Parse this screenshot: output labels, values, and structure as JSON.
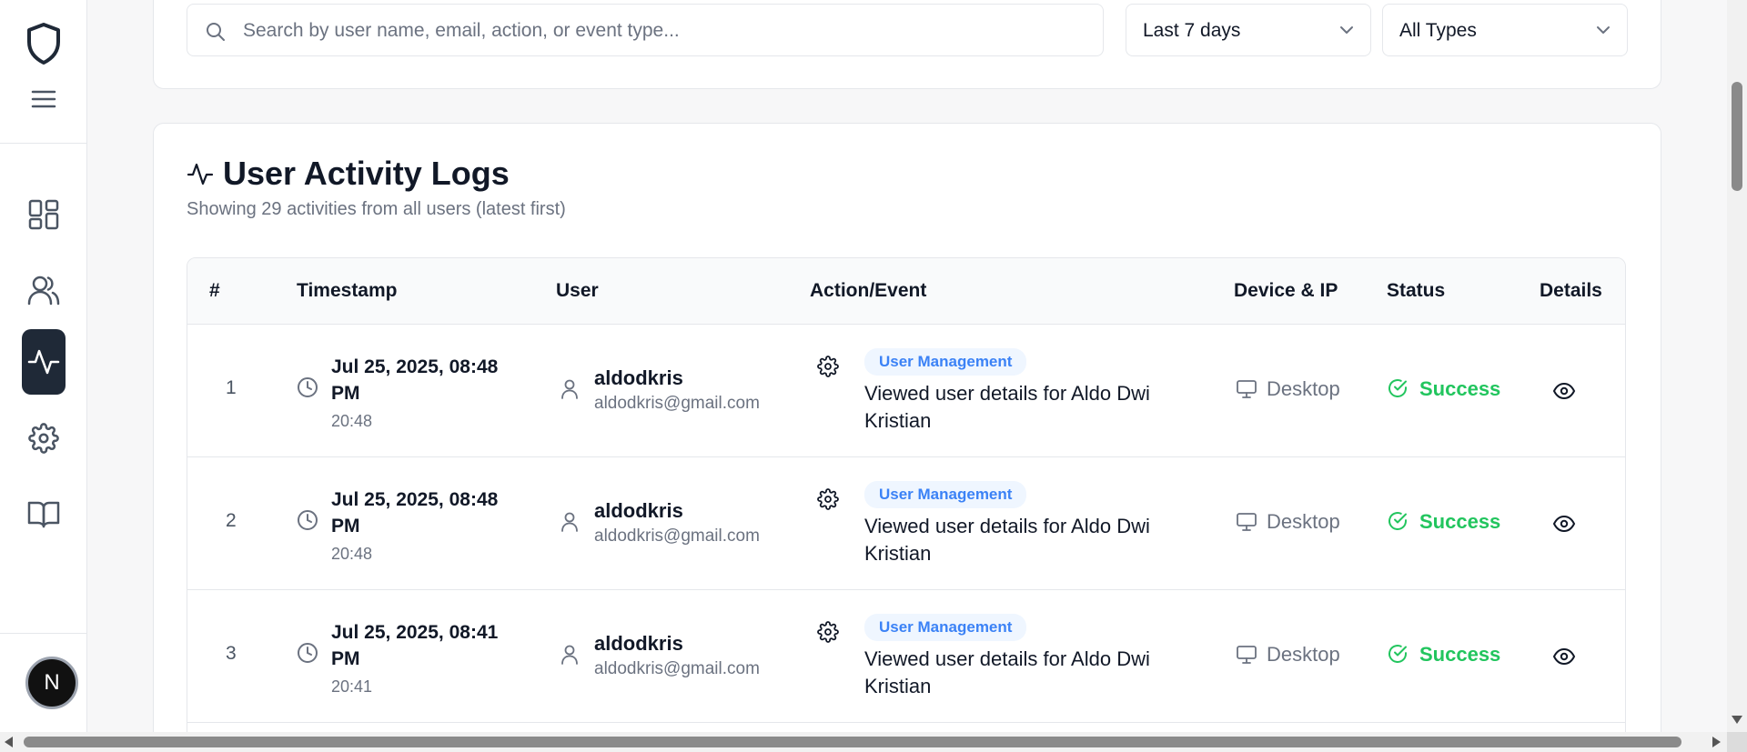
{
  "sidebar": {
    "items": [
      {
        "icon": "dashboard-icon",
        "active": false
      },
      {
        "icon": "users-icon",
        "active": false
      },
      {
        "icon": "activity-icon",
        "active": true
      },
      {
        "icon": "gear-icon",
        "active": false
      },
      {
        "icon": "book-icon",
        "active": false
      }
    ],
    "avatar_letter": "N"
  },
  "filters": {
    "search_placeholder": "Search by user name, email, action, or event type...",
    "date_range": "Last 7 days",
    "type": "All Types"
  },
  "logs": {
    "title": "User Activity Logs",
    "subtitle": "Showing 29 activities from all users (latest first)",
    "columns": [
      "#",
      "Timestamp",
      "User",
      "Action/Event",
      "Device & IP",
      "Status",
      "Details"
    ],
    "rows": [
      {
        "num": "1",
        "date": "Jul 25, 2025, 08:48 PM",
        "time": "20:48",
        "user": "aldodkris",
        "email": "aldodkris@gmail.com",
        "category": "User Management",
        "action": "Viewed user details for Aldo Dwi Kristian",
        "device": "Desktop",
        "status": "Success"
      },
      {
        "num": "2",
        "date": "Jul 25, 2025, 08:48 PM",
        "time": "20:48",
        "user": "aldodkris",
        "email": "aldodkris@gmail.com",
        "category": "User Management",
        "action": "Viewed user details for Aldo Dwi Kristian",
        "device": "Desktop",
        "status": "Success"
      },
      {
        "num": "3",
        "date": "Jul 25, 2025, 08:41 PM",
        "time": "20:41",
        "user": "aldodkris",
        "email": "aldodkris@gmail.com",
        "category": "User Management",
        "action": "Viewed user details for Aldo Dwi Kristian",
        "device": "Desktop",
        "status": "Success"
      }
    ]
  },
  "colors": {
    "accent": "#1f2937",
    "badge_bg": "#eff6ff",
    "badge_text": "#3b82f6",
    "success": "#22c55e"
  }
}
